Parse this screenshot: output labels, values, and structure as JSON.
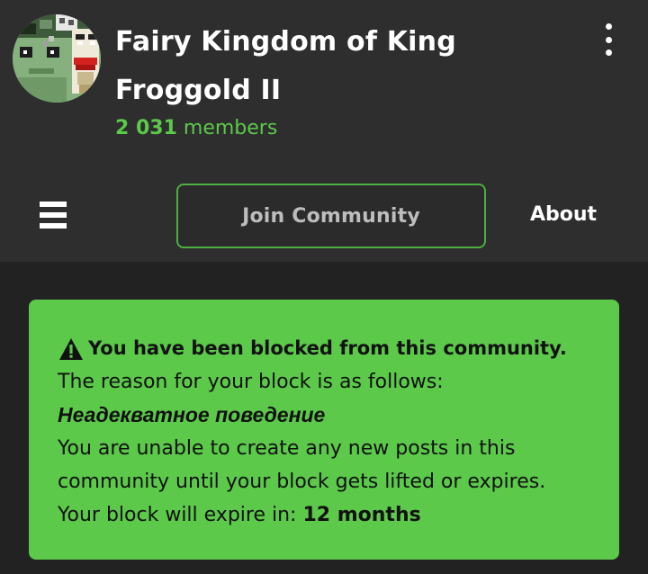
{
  "community": {
    "title": "Fairy Kingdom of King Froggold II",
    "member_count": "2 031",
    "member_label": "members",
    "avatar_icon": "pixel-art-frog-king-avatar",
    "menu_icon": "vertical-ellipsis-icon"
  },
  "nav": {
    "menu_icon": "hamburger-menu-icon",
    "join_label": "Join Community",
    "about_label": "About"
  },
  "notice": {
    "icon": "warning-triangle-icon",
    "headline": "You have been blocked from this community.",
    "reason_intro": "The reason for your block is as follows:",
    "reason": "Неадекватное поведение",
    "body": "You are unable to create any new posts in this community until your block gets lifted or expires.",
    "expire_prefix": "Your block will expire in:",
    "expire_value": "12 months"
  },
  "colors": {
    "accent": "#5cc94a",
    "header_bg": "#2e2e2e",
    "page_bg": "#222222",
    "join_border": "#4fae42"
  }
}
